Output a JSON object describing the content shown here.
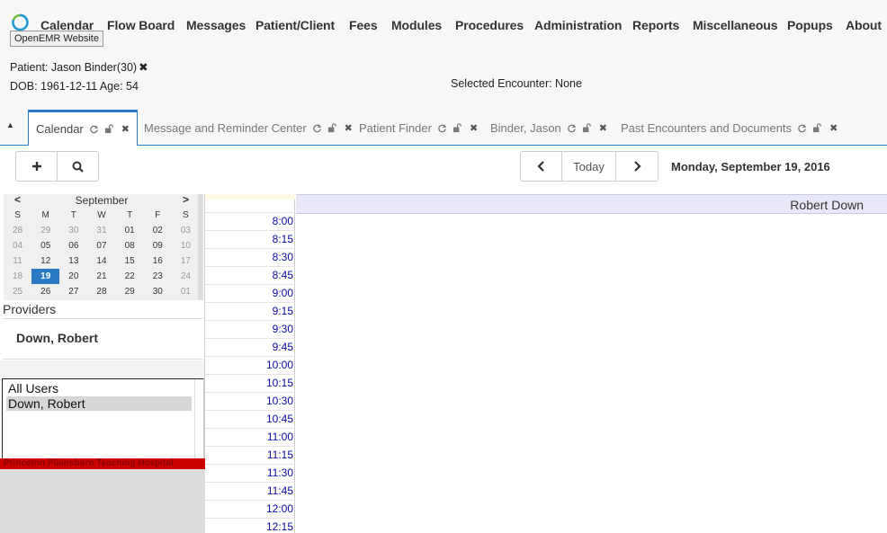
{
  "menubar": {
    "logo_icon": "openemr-logo-icon",
    "items": [
      "Calendar",
      "Flow Board",
      "Messages",
      "Patient/Client",
      "Fees",
      "Modules",
      "Procedures",
      "Administration",
      "Reports",
      "Miscellaneous",
      "Popups",
      "About"
    ],
    "tooltip": "OpenEMR Website"
  },
  "patient": {
    "label": "Patient: Jason Binder(30)",
    "dob_age": "DOB: 1961-12-11 Age: 54",
    "encounter": "Selected Encounter: None"
  },
  "tabs": [
    {
      "label": "Calendar",
      "active": true
    },
    {
      "label": "Message and Reminder Center",
      "active": false
    },
    {
      "label": "Patient Finder",
      "active": false
    },
    {
      "label": "Binder, Jason",
      "active": false
    },
    {
      "label": "Past Encounters and Documents",
      "active": false
    }
  ],
  "toolbar": {
    "add_icon": "plus-icon",
    "search_icon": "search-icon",
    "prev_icon": "chevron-left-icon",
    "today_label": "Today",
    "next_icon": "chevron-right-icon",
    "current_date": "Monday, September 19, 2016"
  },
  "mini_calendar": {
    "month": "September",
    "weekdays": [
      "S",
      "M",
      "T",
      "W",
      "T",
      "F",
      "S"
    ],
    "weeks": [
      [
        "28",
        "29",
        "30",
        "31",
        "01",
        "02",
        "03"
      ],
      [
        "04",
        "05",
        "06",
        "07",
        "08",
        "09",
        "10"
      ],
      [
        "11",
        "12",
        "13",
        "14",
        "15",
        "16",
        "17"
      ],
      [
        "18",
        "19",
        "20",
        "21",
        "22",
        "23",
        "24"
      ],
      [
        "25",
        "26",
        "27",
        "28",
        "29",
        "30",
        "01"
      ]
    ],
    "selected_day": "19"
  },
  "providers": {
    "header": "Providers",
    "current": "Down, Robert",
    "list": [
      "All Users",
      "Down, Robert"
    ],
    "selected": "Down, Robert"
  },
  "facility": "Princeton Plainsboro Teaching Hospital",
  "day_view": {
    "provider_header": "Robert Down",
    "times": [
      "8:00",
      "8:15",
      "8:30",
      "8:45",
      "9:00",
      "9:15",
      "9:30",
      "9:45",
      "10:00",
      "10:15",
      "10:30",
      "10:45",
      "11:00",
      "11:15",
      "11:30",
      "11:45",
      "12:00",
      "12:15"
    ]
  },
  "colors": {
    "accent": "#2a79c4",
    "time_text": "#0a0aa8",
    "facility_bar": "#cc0000",
    "selected_day_bg": "#2a79c4"
  }
}
